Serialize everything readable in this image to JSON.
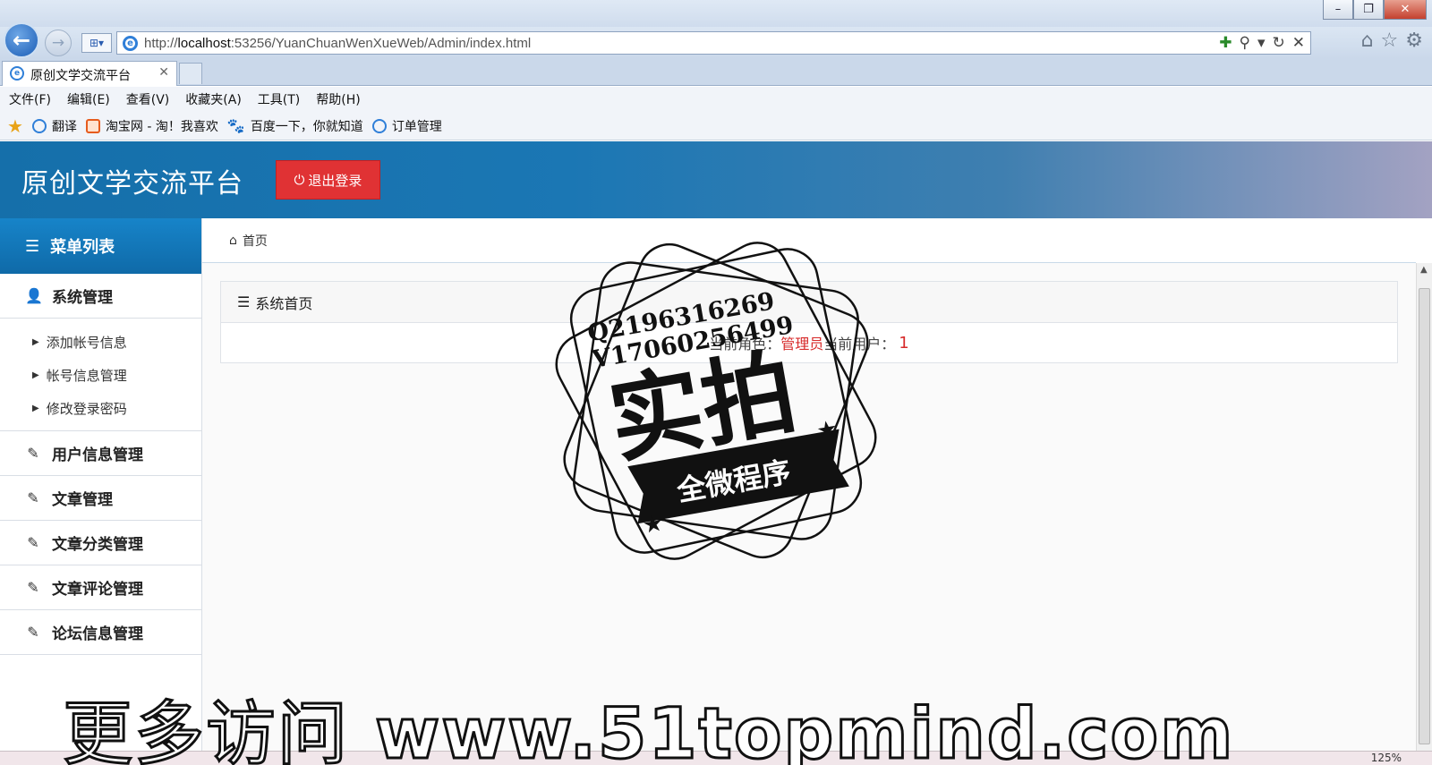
{
  "browser": {
    "url_prefix": "http://",
    "url_host": "localhost",
    "url_rest": ":53256/YuanChuanWenXueWeb/Admin/index.html",
    "tab_title": "原创文学交流平台",
    "menus": [
      "文件(F)",
      "编辑(E)",
      "查看(V)",
      "收藏夹(A)",
      "工具(T)",
      "帮助(H)"
    ],
    "favorites": [
      "翻译",
      "淘宝网 - 淘！我喜欢",
      "百度一下，你就知道",
      "订单管理"
    ],
    "zoom": "125%"
  },
  "header": {
    "title": "原创文学交流平台",
    "logout_label": "退出登录"
  },
  "sidebar": {
    "heading": "菜单列表",
    "groups": [
      {
        "label": "系统管理",
        "items": [
          "添加帐号信息",
          "帐号信息管理",
          "修改登录密码"
        ]
      },
      {
        "label": "用户信息管理"
      },
      {
        "label": "文章管理"
      },
      {
        "label": "文章分类管理"
      },
      {
        "label": "文章评论管理"
      },
      {
        "label": "论坛信息管理"
      }
    ]
  },
  "main": {
    "breadcrumb": "首页",
    "panel_title": "系统首页",
    "role_label": "当前角色：",
    "role_value": "管理员",
    "user_label": "当前用户：",
    "user_value": "1"
  },
  "watermark": {
    "line1": "Q2196316269",
    "line2": "V17060256499",
    "big": "实拍",
    "ribbon": "全微程序",
    "bottom_cn": "更多访问",
    "bottom_url": "www.51topmind.com"
  },
  "colors": {
    "header_blue": "#1b77b4",
    "logout_red": "#e03234",
    "highlight_red": "#d72b2b"
  },
  "icons": {
    "back": "back-arrow-icon",
    "forward": "forward-arrow-icon",
    "home": "home-icon",
    "star": "star-icon",
    "gear": "gear-icon",
    "power": "power-icon",
    "list": "list-icon",
    "user": "user-icon",
    "edit": "edit-icon"
  }
}
